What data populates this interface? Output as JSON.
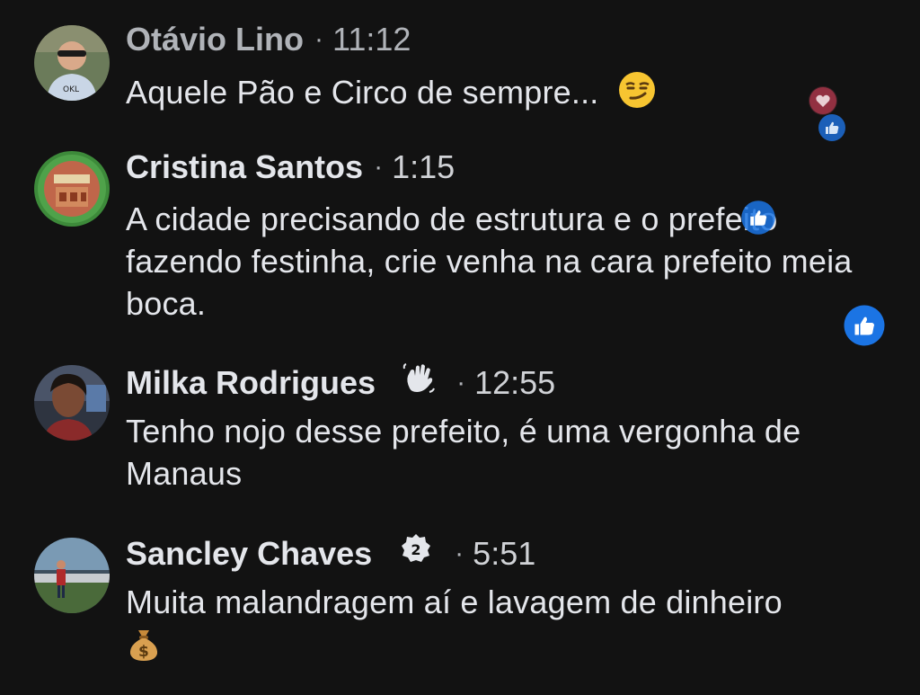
{
  "comments": [
    {
      "name": "Otávio Lino",
      "time": "11:12",
      "text": "Aquele Pão e Circo de sempre...",
      "avatar_icon": "person-photo-avatar",
      "emoji": "smirk-emoji",
      "reactions": [
        "love-reaction",
        "like-reaction"
      ]
    },
    {
      "name": "Cristina Santos",
      "time": "1:15",
      "text": "A cidade precisando de estrutura e o prefeito fazendo festinha, crie venha na cara prefeito meia boca.",
      "avatar_icon": "shop-photo-avatar",
      "reactions": [
        "like-reaction",
        "like-reaction"
      ]
    },
    {
      "name": "Milka Rodrigues",
      "time": "12:55",
      "text": "Tenho nojo desse prefeito, é uma vergonha de Manaus",
      "avatar_icon": "person-photo-avatar",
      "badge": "wave-hand-icon"
    },
    {
      "name": "Sancley Chaves",
      "time": "5:51",
      "text": "Muita malandragem aí e lavagem de dinheiro",
      "avatar_icon": "person-photo-avatar",
      "badge": "top-fan-2-badge",
      "emoji": "money-bag-emoji"
    }
  ],
  "colors": {
    "background": "#121212",
    "text": "#e4e6eb",
    "secondary_text": "#b0b3b8",
    "like_blue": "#1b74e4",
    "love_red": "#f33e58"
  }
}
